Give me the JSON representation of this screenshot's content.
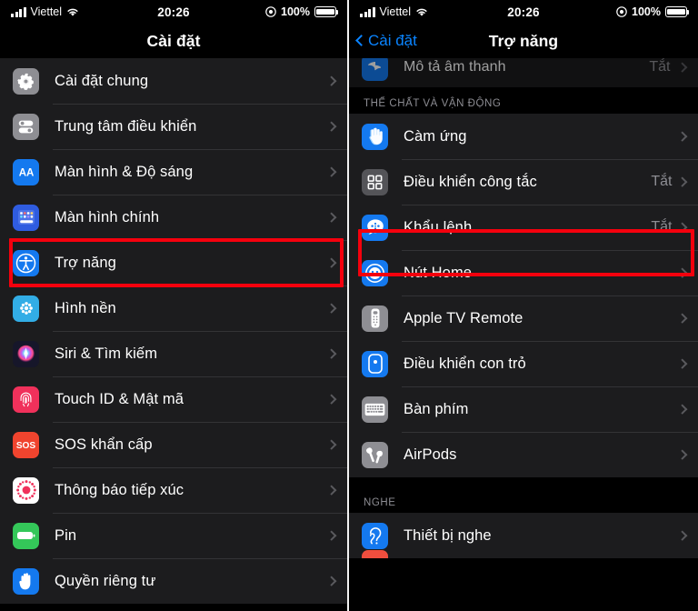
{
  "status_bar": {
    "carrier": "Viettel",
    "time": "20:26",
    "battery_percent": "100%",
    "signal_icon": "cellular-bars-icon",
    "wifi_icon": "wifi-icon",
    "lock_rotation_icon": "rotation-lock-icon",
    "battery_icon": "battery-full-icon"
  },
  "colors": {
    "highlight": "#f5000d",
    "accent_blue": "#0a84ff",
    "row_bg": "#1c1c1e",
    "page_bg": "#000000",
    "secondary_text": "#8d8d93"
  },
  "left_screen": {
    "nav": {
      "title": "Cài đặt"
    },
    "highlighted_item": "Trợ năng",
    "items": [
      {
        "label": "Cài đặt chung",
        "icon": "gear-icon",
        "icon_color": "#8e8e93"
      },
      {
        "label": "Trung tâm điều khiển",
        "icon": "control-center-icon",
        "icon_color": "#8e8e93"
      },
      {
        "label": "Màn hình & Độ sáng",
        "icon": "display-aa-icon",
        "icon_color": "#1479ef"
      },
      {
        "label": "Màn hình chính",
        "icon": "home-screen-icon",
        "icon_color": "#2f5ce0"
      },
      {
        "label": "Trợ năng",
        "icon": "accessibility-icon",
        "icon_color": "#1479ef"
      },
      {
        "label": "Hình nền",
        "icon": "wallpaper-icon",
        "icon_color": "#32ade6"
      },
      {
        "label": "Siri & Tìm kiếm",
        "icon": "siri-icon",
        "icon_color": "#1c1c2e"
      },
      {
        "label": "Touch ID & Mật mã",
        "icon": "touch-id-icon",
        "icon_color": "#f0315b"
      },
      {
        "label": "SOS khẩn cấp",
        "icon": "sos-icon",
        "icon_color": "#f0442e"
      },
      {
        "label": "Thông báo tiếp xúc",
        "icon": "exposure-notification-icon",
        "icon_color": "#ffffff"
      },
      {
        "label": "Pin",
        "icon": "battery-icon",
        "icon_color": "#34c759"
      },
      {
        "label": "Quyền riêng tư",
        "icon": "privacy-hand-icon",
        "icon_color": "#1479ef"
      }
    ]
  },
  "right_screen": {
    "nav": {
      "back_label": "Cài đặt",
      "title": "Trợ năng",
      "back_icon": "chevron-left-icon"
    },
    "peek_row": {
      "label": "Mô tả âm thanh",
      "value": "Tắt",
      "icon": "audio-description-icon",
      "icon_color": "#1479ef"
    },
    "highlighted_item": "Khẩu lệnh",
    "sections": [
      {
        "header": "THỂ CHẤT VÀ VẬN ĐỘNG",
        "items": [
          {
            "label": "Càm ứng",
            "value": "",
            "icon": "touch-hand-icon",
            "icon_color": "#1479ef"
          },
          {
            "label": "Điều khiển công tắc",
            "value": "Tắt",
            "icon": "switch-control-icon",
            "icon_color": "#545458"
          },
          {
            "label": "Khẩu lệnh",
            "value": "Tắt",
            "icon": "voice-control-icon",
            "icon_color": "#1479ef"
          },
          {
            "label": "Nút Home",
            "value": "",
            "icon": "home-button-icon",
            "icon_color": "#1479ef"
          },
          {
            "label": "Apple TV Remote",
            "value": "",
            "icon": "apple-tv-remote-icon",
            "icon_color": "#8e8e93"
          },
          {
            "label": "Điều khiển con trỏ",
            "value": "",
            "icon": "pointer-control-icon",
            "icon_color": "#1479ef"
          },
          {
            "label": "Bàn phím",
            "value": "",
            "icon": "keyboard-icon",
            "icon_color": "#8e8e93"
          },
          {
            "label": "AirPods",
            "value": "",
            "icon": "airpods-icon",
            "icon_color": "#8e8e93"
          }
        ]
      },
      {
        "header": "NGHE",
        "items": [
          {
            "label": "Thiết bị nghe",
            "value": "",
            "icon": "hearing-devices-icon",
            "icon_color": "#1479ef"
          }
        ]
      }
    ]
  }
}
